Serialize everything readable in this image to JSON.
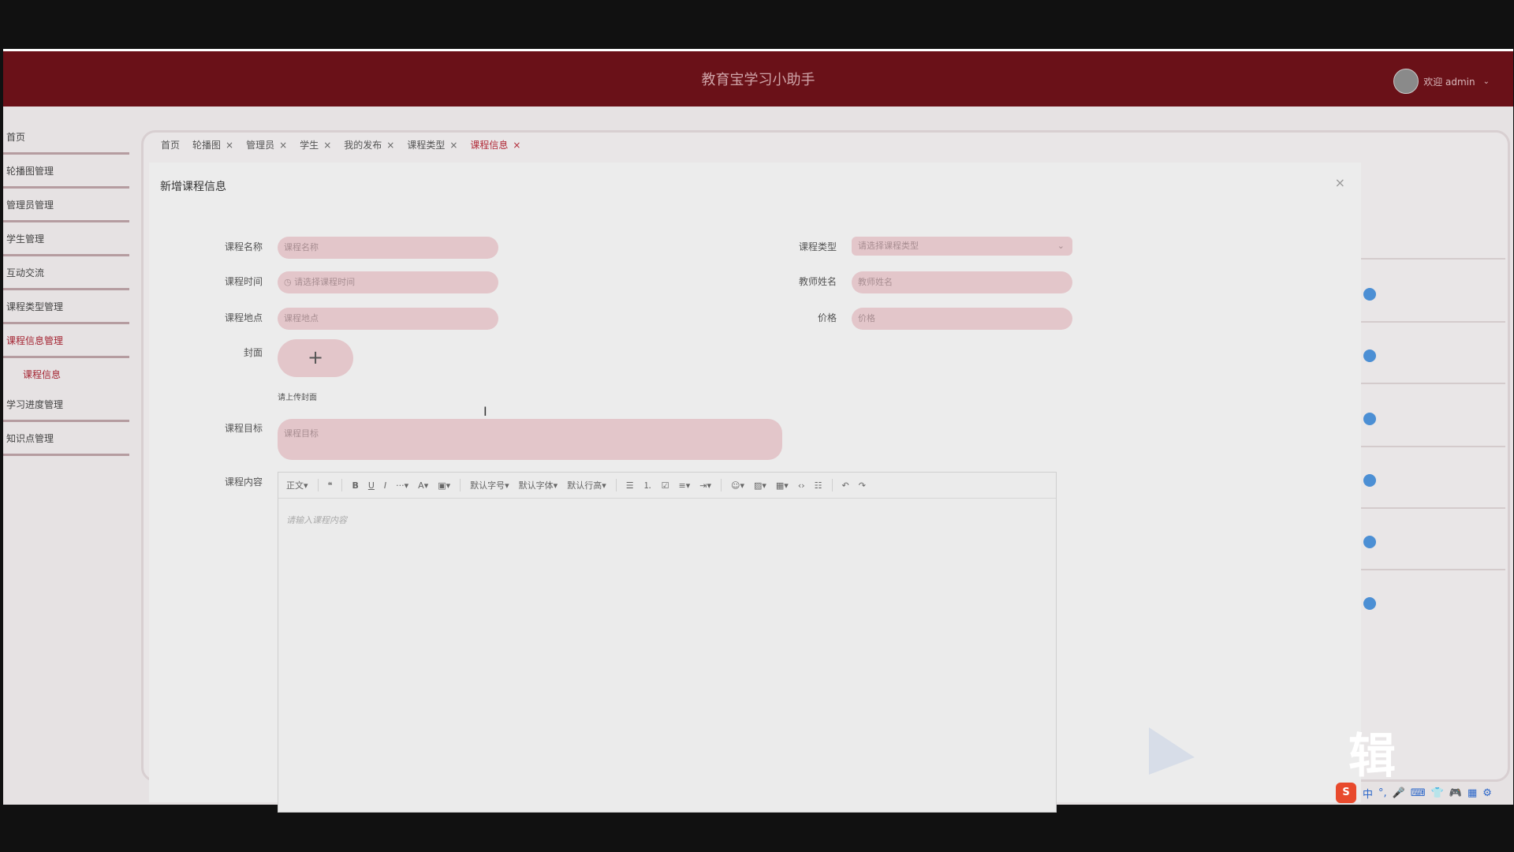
{
  "app": {
    "title": "教育宝学习小助手",
    "user_greeting": "欢迎 admin"
  },
  "sidebar": {
    "items": [
      {
        "label": "首页"
      },
      {
        "label": "轮播图管理"
      },
      {
        "label": "管理员管理"
      },
      {
        "label": "学生管理"
      },
      {
        "label": "互动交流"
      },
      {
        "label": "课程类型管理"
      },
      {
        "label": "课程信息管理",
        "active": true
      },
      {
        "label": "学习进度管理"
      },
      {
        "label": "知识点管理"
      }
    ],
    "sub_item": "课程信息"
  },
  "tabs": [
    {
      "label": "首页"
    },
    {
      "label": "轮播图",
      "close": "×"
    },
    {
      "label": "管理员",
      "close": "×"
    },
    {
      "label": "学生",
      "close": "×"
    },
    {
      "label": "我的发布",
      "close": "×"
    },
    {
      "label": "课程类型",
      "close": "×"
    },
    {
      "label": "课程信息",
      "close": "×",
      "active": true
    }
  ],
  "modal": {
    "title": "新增课程信息",
    "close": "×",
    "fields": {
      "course_name": {
        "label": "课程名称",
        "placeholder": "课程名称"
      },
      "course_type": {
        "label": "课程类型",
        "placeholder": "请选择课程类型"
      },
      "course_time": {
        "label": "课程时间",
        "placeholder": "请选择课程时间"
      },
      "teacher": {
        "label": "教师姓名",
        "placeholder": "教师姓名"
      },
      "location": {
        "label": "课程地点",
        "placeholder": "课程地点"
      },
      "price": {
        "label": "价格",
        "placeholder": "价格"
      },
      "cover": {
        "label": "封面",
        "plus": "+",
        "hint": "请上传封面"
      },
      "goal": {
        "label": "课程目标",
        "placeholder": "课程目标"
      },
      "content": {
        "label": "课程内容",
        "placeholder": "请输入课程内容"
      }
    },
    "toolbar": [
      "正文▾",
      "❝",
      "B",
      "U",
      "I",
      "···▾",
      "A▾",
      "▣▾",
      "默认字号▾",
      "默认字体▾",
      "默认行高▾",
      "☰",
      "⒈",
      "☑",
      "≡▾",
      "⇥▾",
      "☺▾",
      "▨▾",
      "▦▾",
      "‹›",
      "☷",
      "↶",
      "↷"
    ]
  },
  "overlay": {
    "watermark_text": "辑",
    "tray": [
      "中",
      "°,",
      "🎤",
      "⌨",
      "👕",
      "🎮",
      "▦",
      "⚙"
    ]
  }
}
